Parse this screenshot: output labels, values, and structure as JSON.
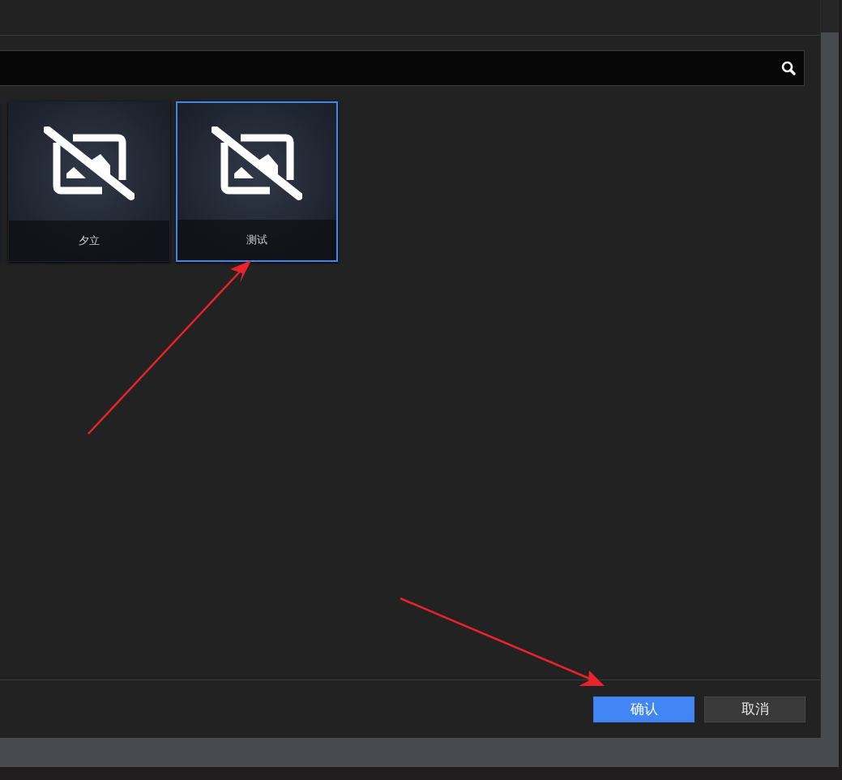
{
  "tiles": [
    {
      "label": "夕立",
      "selected": false
    },
    {
      "label": "测试",
      "selected": true
    }
  ],
  "buttons": [
    {
      "label": "确认",
      "kind": "primary"
    },
    {
      "label": "取消",
      "kind": "secondary"
    }
  ]
}
